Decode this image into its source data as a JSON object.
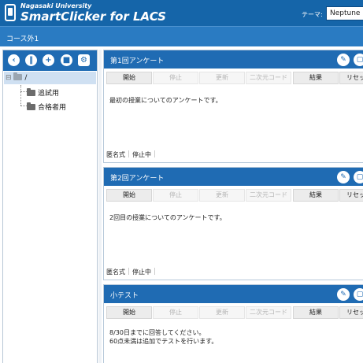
{
  "header": {
    "brand_small": "Nagasaki University",
    "brand_big": "SmartClicker for LACS",
    "theme_label": "テーマ:",
    "theme_value": "Neptune"
  },
  "subheader": {
    "course": "コース外1"
  },
  "sidebar": {
    "toolbar_icons": [
      "back-icon",
      "pause-icon",
      "add-icon",
      "delete-icon",
      "gear-icon"
    ],
    "tree": {
      "root": "/",
      "children": [
        "追試用",
        "合格者用"
      ]
    }
  },
  "panels": [
    {
      "title": "第1回アンケート",
      "buttons": [
        "開始",
        "停止",
        "更新",
        "二次元コード",
        "結果",
        "リセット"
      ],
      "body": [
        "最初の授業についてのアンケートです。"
      ],
      "anon_label": "匿名式",
      "status": "停止中"
    },
    {
      "title": "第2回アンケート",
      "buttons": [
        "開始",
        "停止",
        "更新",
        "二次元コード",
        "結果",
        "リセット"
      ],
      "body": [
        "2回目の授業についてのアンケートです。"
      ],
      "anon_label": "匿名式",
      "status": "停止中"
    },
    {
      "title": "小テスト",
      "buttons": [
        "開始",
        "停止",
        "更新",
        "二次元コード",
        "結果",
        "リセット"
      ],
      "body": [
        "8/30日までに回答してください。",
        "60点未満は追加でテストを行います。"
      ]
    }
  ],
  "colors": {
    "header_bg": "#1565a9",
    "accent": "#1f6bb3",
    "tree_selected": "#cfe0f2"
  }
}
